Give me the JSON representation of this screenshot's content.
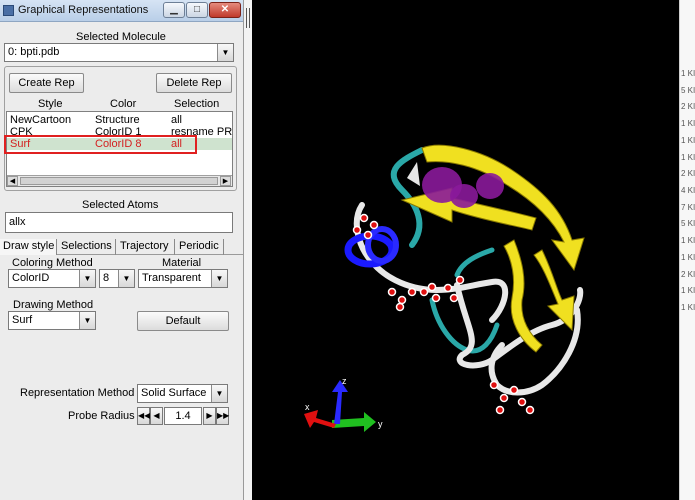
{
  "window": {
    "title": "Graphical Representations"
  },
  "selected_molecule": {
    "label": "Selected Molecule",
    "value": "0: bpti.pdb"
  },
  "buttons": {
    "create_rep": "Create Rep",
    "delete_rep": "Delete Rep",
    "default": "Default"
  },
  "rep_table": {
    "headers": [
      "Style",
      "Color",
      "Selection"
    ],
    "rows": [
      [
        "NewCartoon",
        "Structure",
        "all"
      ],
      [
        "CPK",
        "ColorID 1",
        "resname PR"
      ],
      [
        "Surf",
        "ColorID 8",
        "all"
      ]
    ],
    "selected_row": 2
  },
  "selected_atoms": {
    "label": "Selected Atoms",
    "value": "allx"
  },
  "tabs": [
    "Draw style",
    "Selections",
    "Trajectory",
    "Periodic"
  ],
  "coloring": {
    "label": "Coloring Method",
    "method": "ColorID",
    "id": "8"
  },
  "material": {
    "label": "Material",
    "value": "Transparent"
  },
  "drawing": {
    "label": "Drawing Method",
    "value": "Surf"
  },
  "representation_method": {
    "label": "Representation Method",
    "value": "Solid Surface"
  },
  "probe_radius": {
    "label": "Probe Radius",
    "value": "1.4"
  },
  "axes": {
    "x": "x",
    "y": "y",
    "z": "z"
  },
  "background_window_lines": [
    "1 KI",
    "5 KI",
    "2 KI",
    "1 KI",
    "1 KI",
    "1 KI",
    "2 KI",
    "4 KI",
    "7 KI",
    "5 KI",
    "1 KI",
    "1 KI",
    "2 KI",
    "1 KI",
    "1 KI"
  ],
  "colors": {
    "helix": "#1a1aff",
    "sheet": "#f0e020",
    "coil": "#e8e8e8",
    "turn": "#2aa8a8",
    "surface": "#8a1a9a",
    "selection_box": "#e02020"
  }
}
